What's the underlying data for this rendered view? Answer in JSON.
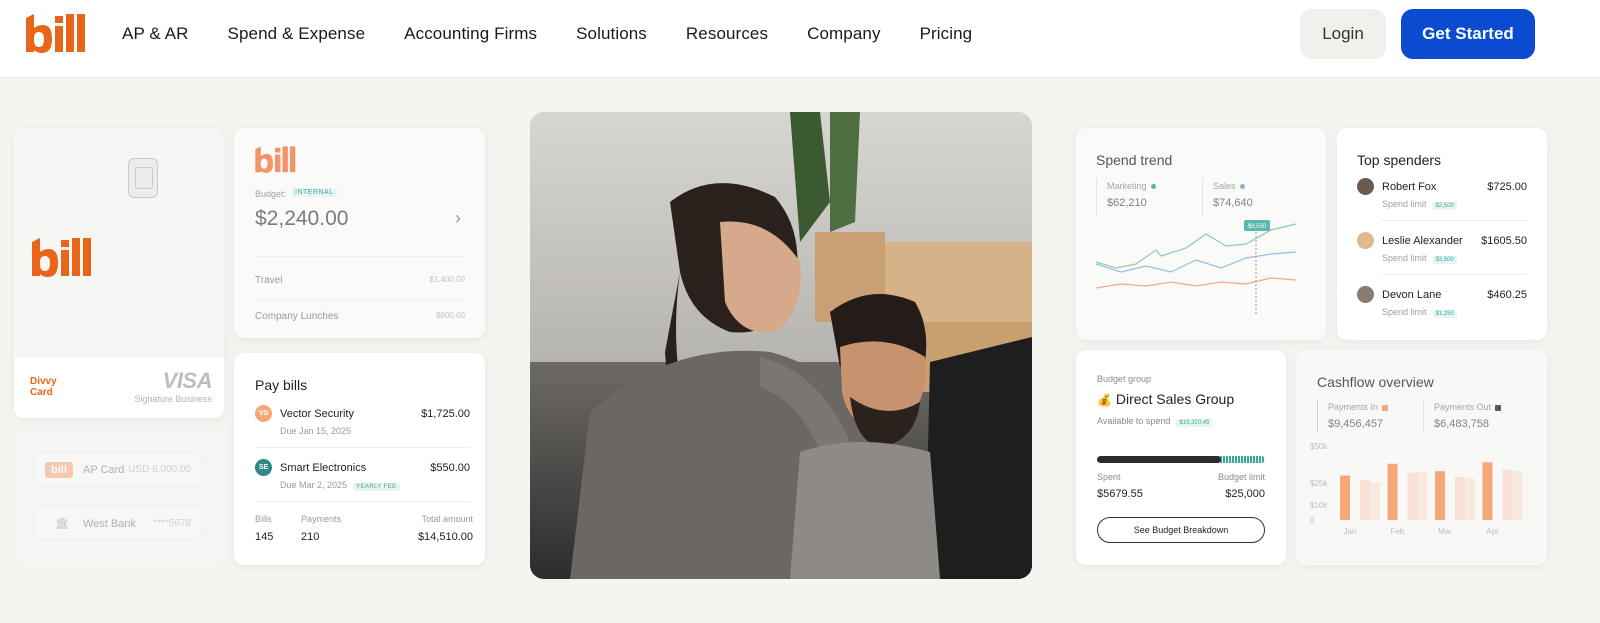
{
  "header": {
    "logo": "bill",
    "nav": [
      "AP & AR",
      "Spend & Expense",
      "Accounting Firms",
      "Solutions",
      "Resources",
      "Company",
      "Pricing"
    ],
    "login_label": "Login",
    "get_started_label": "Get Started",
    "brand_color": "#e8651a",
    "cta_color": "#0a4bd1"
  },
  "divvy_card": {
    "logo": "bill",
    "label": "Divvy Card",
    "network": "VISA",
    "network_sub": "Signature Business"
  },
  "ap_list": [
    {
      "tag": "bill",
      "label": "AP Card",
      "value": "USD 8,000.00"
    },
    {
      "icon": "bank-icon",
      "label": "West Bank",
      "value": "****5678"
    }
  ],
  "budget_card": {
    "logo": "bill",
    "label": "Budget:",
    "tag": "INTERNAL",
    "amount": "$2,240.00",
    "rows": [
      {
        "label": "Travel",
        "value": "$1,400.00"
      },
      {
        "label": "Company Lunches",
        "value": "$800.00"
      }
    ]
  },
  "pay_bills": {
    "title": "Pay bills",
    "items": [
      {
        "initials": "VS",
        "name": "Vector Security",
        "amount": "$1,725.00",
        "due": "Due Jan 15, 2025",
        "tag": "",
        "color": "#f5a77a"
      },
      {
        "initials": "SE",
        "name": "Smart Electronics",
        "amount": "$550.00",
        "due": "Due Mar 2, 2025",
        "tag": "YEARLY FEE",
        "color": "#2e8b83"
      }
    ],
    "footer": {
      "bills_label": "Bills",
      "bills_value": "145",
      "payments_label": "Payments",
      "payments_value": "210",
      "total_label": "Total amount",
      "total_value": "$14,510.00"
    }
  },
  "spend_trend": {
    "title": "Spend trend",
    "marketing_label": "Marketing",
    "marketing_value": "$62,210",
    "sales_label": "Sales",
    "sales_value": "$74,640",
    "tooltip": "$9,550"
  },
  "top_spenders": {
    "title": "Top spenders",
    "limit_label": "Spend limit",
    "items": [
      {
        "name": "Robert Fox",
        "amount": "$725.00",
        "limit": "$2,500"
      },
      {
        "name": "Leslie Alexander",
        "amount": "$1605.50",
        "limit": "$3,500"
      },
      {
        "name": "Devon Lane",
        "amount": "$460.25",
        "limit": "$1,250"
      }
    ]
  },
  "budget_group": {
    "label": "Budget group",
    "title": "Direct Sales Group",
    "available_label": "Available to spend",
    "available_value": "$19,320.45",
    "progress": 0.74,
    "spent_label": "Spent",
    "spent_value": "$5679.55",
    "limit_label": "Budget limit",
    "limit_value": "$25,000",
    "button_label": "See Budget Breakdown"
  },
  "cashflow": {
    "title": "Cashflow overview",
    "in_label": "Payments In",
    "in_value": "$9,456,457",
    "out_label": "Payments Out",
    "out_value": "$6,483,758"
  },
  "chart_data": {
    "type": "bar",
    "categories": [
      "Jan",
      "Feb",
      "Mar",
      "Apr"
    ],
    "y_ticks": [
      "$50k",
      "$25k",
      "$10k",
      "0"
    ],
    "ylim": [
      0,
      50
    ],
    "series": [
      {
        "name": "Payments In",
        "color": "#f5a77a",
        "values": [
          30,
          38,
          33,
          39
        ]
      },
      {
        "name": "Payments Out",
        "color": "#f7e1d4",
        "values": [
          27,
          32,
          29,
          34
        ]
      }
    ]
  }
}
